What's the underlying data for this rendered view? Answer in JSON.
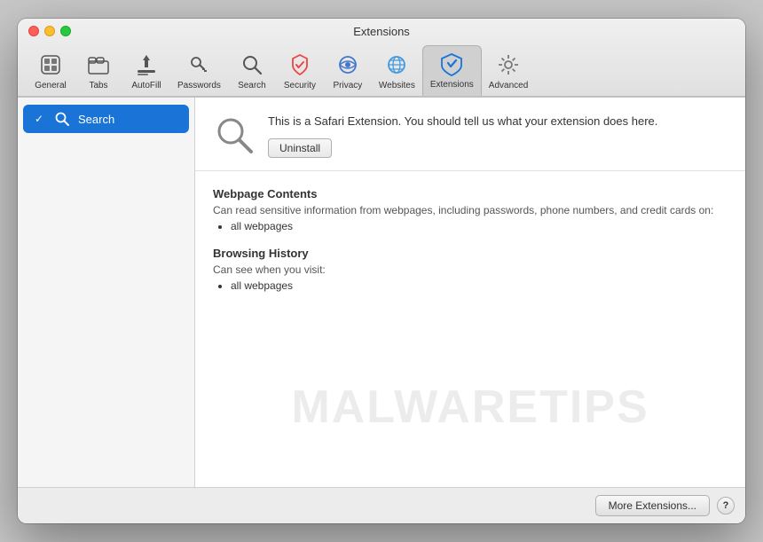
{
  "window": {
    "title": "Extensions"
  },
  "toolbar": {
    "items": [
      {
        "id": "general",
        "label": "General",
        "icon": "general-icon"
      },
      {
        "id": "tabs",
        "label": "Tabs",
        "icon": "tabs-icon"
      },
      {
        "id": "autofill",
        "label": "AutoFill",
        "icon": "autofill-icon"
      },
      {
        "id": "passwords",
        "label": "Passwords",
        "icon": "passwords-icon"
      },
      {
        "id": "search",
        "label": "Search",
        "icon": "search-icon"
      },
      {
        "id": "security",
        "label": "Security",
        "icon": "security-icon"
      },
      {
        "id": "privacy",
        "label": "Privacy",
        "icon": "privacy-icon"
      },
      {
        "id": "websites",
        "label": "Websites",
        "icon": "websites-icon"
      },
      {
        "id": "extensions",
        "label": "Extensions",
        "icon": "extensions-icon",
        "active": true
      },
      {
        "id": "advanced",
        "label": "Advanced",
        "icon": "advanced-icon"
      }
    ]
  },
  "sidebar": {
    "items": [
      {
        "id": "search-ext",
        "label": "Search",
        "checked": true,
        "selected": true
      }
    ]
  },
  "extension": {
    "description": "This is a Safari Extension. You should tell us what your extension does here.",
    "uninstall_label": "Uninstall",
    "permissions": [
      {
        "title": "Webpage Contents",
        "desc": "Can read sensitive information from webpages, including passwords, phone numbers, and credit cards on:",
        "items": [
          "all webpages"
        ]
      },
      {
        "title": "Browsing History",
        "desc": "Can see when you visit:",
        "items": [
          "all webpages"
        ]
      }
    ]
  },
  "bottom_bar": {
    "more_extensions_label": "More Extensions...",
    "help_label": "?"
  },
  "watermark": "MALWARETIPS"
}
